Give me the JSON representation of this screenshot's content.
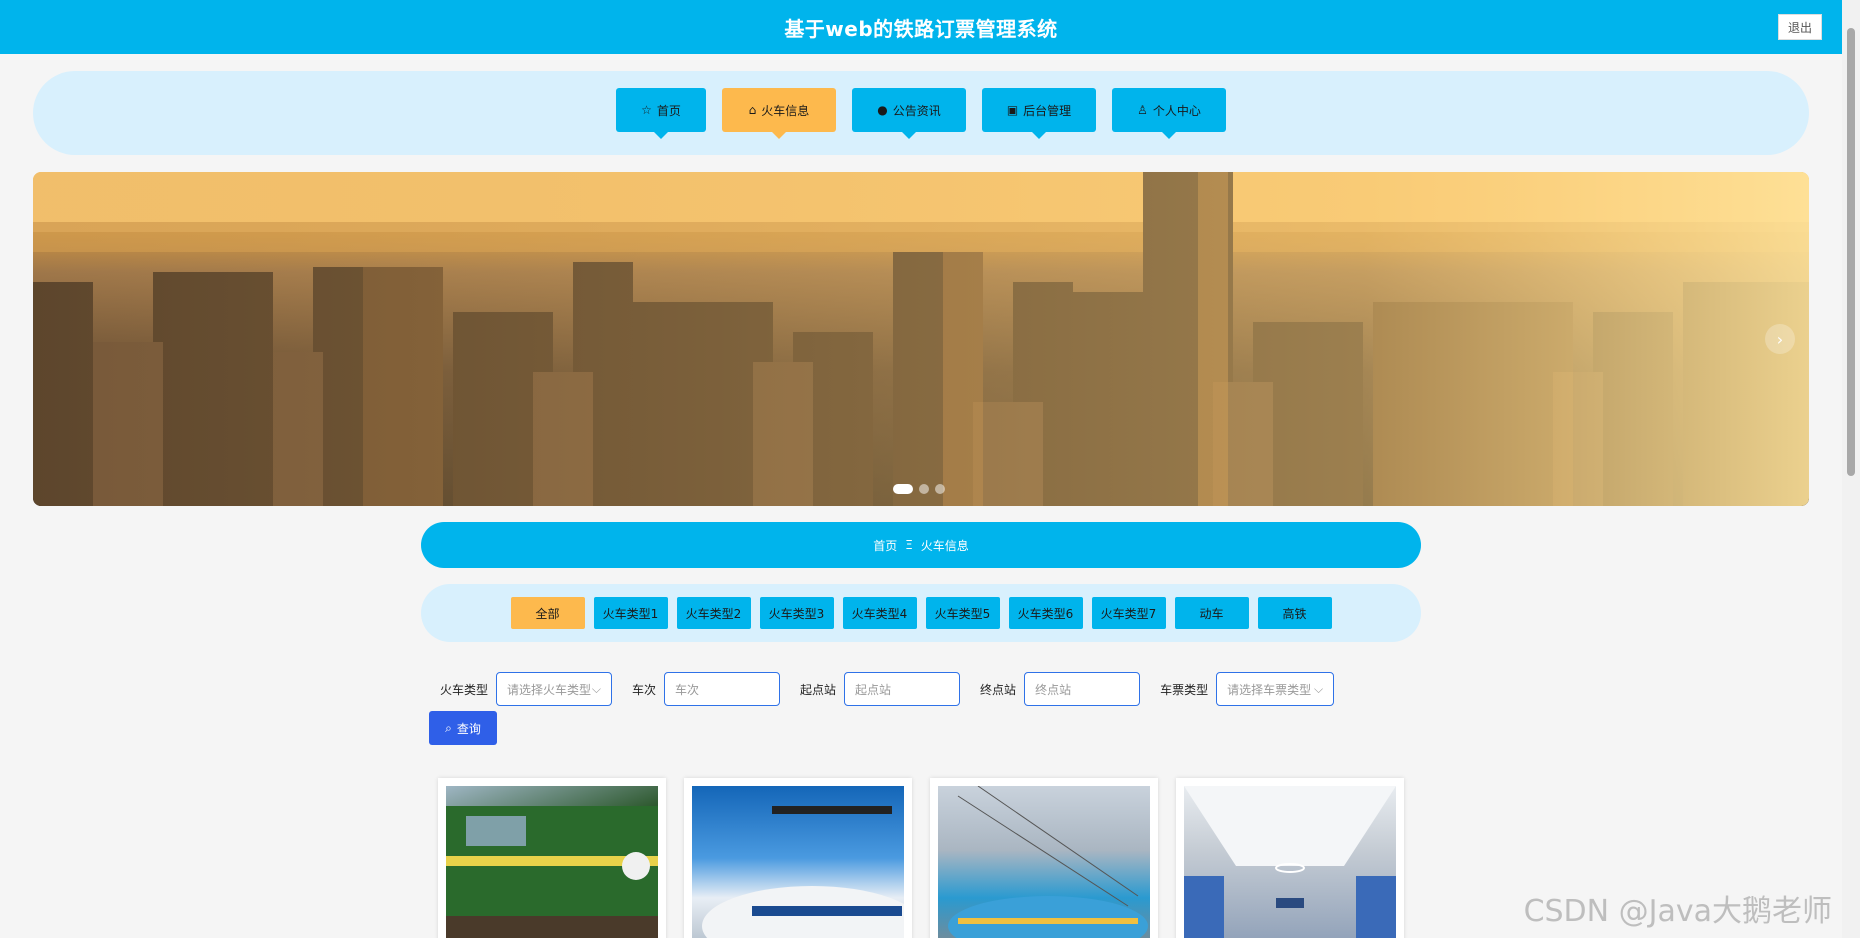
{
  "header": {
    "title": "基于web的铁路订票管理系统",
    "logout_label": "退出"
  },
  "nav": {
    "items": [
      {
        "label": "首页",
        "icon": "star-icon"
      },
      {
        "label": "火车信息",
        "icon": "bag-icon"
      },
      {
        "label": "公告资讯",
        "icon": "info-icon"
      },
      {
        "label": "后台管理",
        "icon": "briefcase-icon"
      },
      {
        "label": "个人中心",
        "icon": "user-icon"
      }
    ],
    "active_index": 1,
    "accent_color": "#00b4ec",
    "active_color": "#fdb94d"
  },
  "banner": {
    "slides": 3,
    "active_slide": 1
  },
  "breadcrumb": {
    "home": "首页",
    "separator": "Ξ",
    "current": "火车信息"
  },
  "categories": {
    "items": [
      "全部",
      "火车类型1",
      "火车类型2",
      "火车类型3",
      "火车类型4",
      "火车类型5",
      "火车类型6",
      "火车类型7",
      "动车",
      "高铁"
    ],
    "active_index": 0
  },
  "search": {
    "train_type_label": "火车类型",
    "train_type_placeholder": "请选择火车类型",
    "train_no_label": "车次",
    "train_no_placeholder": "车次",
    "start_label": "起点站",
    "start_placeholder": "起点站",
    "end_label": "终点站",
    "end_placeholder": "终点站",
    "ticket_type_label": "车票类型",
    "ticket_type_placeholder": "请选择车票类型",
    "query_label": "查询"
  },
  "watermark": "CSDN @Java大鹅老师"
}
